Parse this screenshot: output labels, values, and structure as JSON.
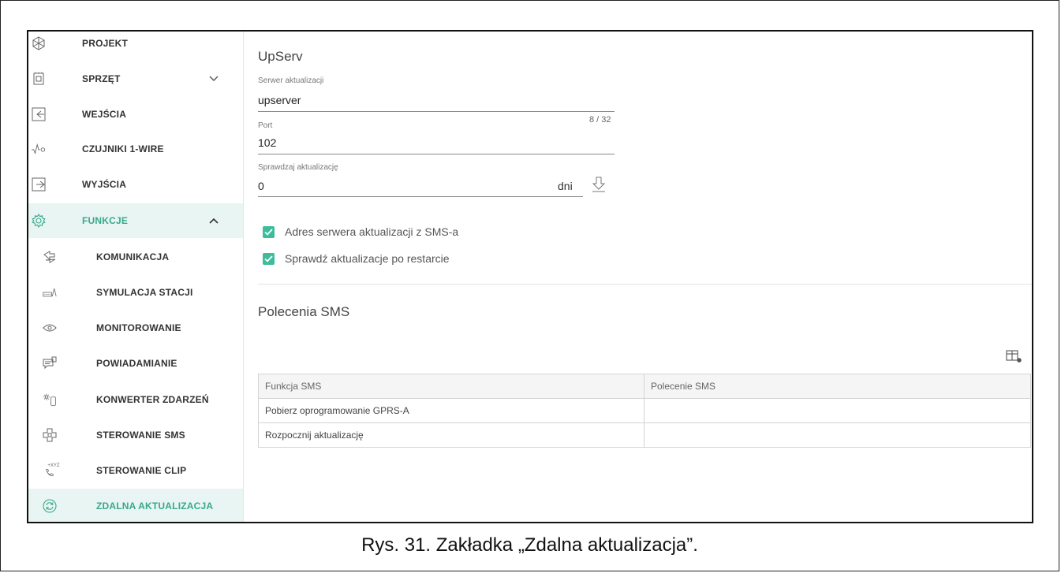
{
  "sidebar": {
    "items": [
      {
        "label": "PROJEKT",
        "icon": "project-icon"
      },
      {
        "label": "SPRZĘT",
        "icon": "hardware-icon",
        "expandable": true,
        "expanded": false
      },
      {
        "label": "WEJŚCIA",
        "icon": "inputs-icon"
      },
      {
        "label": "CZUJNIKI 1-WIRE",
        "icon": "sensor-1wire-icon"
      },
      {
        "label": "WYJŚCIA",
        "icon": "outputs-icon"
      },
      {
        "label": "FUNKCJE",
        "icon": "gear-icon",
        "expandable": true,
        "expanded": true
      },
      {
        "label": "KOMUNIKACJA",
        "icon": "communication-icon"
      },
      {
        "label": "SYMULACJA STACJI",
        "icon": "station-simulation-icon"
      },
      {
        "label": "MONITOROWANIE",
        "icon": "eye-icon"
      },
      {
        "label": "POWIADAMIANIE",
        "icon": "notification-icon"
      },
      {
        "label": "KONWERTER ZDARZEŃ",
        "icon": "event-converter-icon"
      },
      {
        "label": "STEROWANIE SMS",
        "icon": "sms-control-icon"
      },
      {
        "label": "STEROWANIE CLIP",
        "icon": "clip-control-icon",
        "icon_text": "+XYZ"
      },
      {
        "label": "ZDALNA AKTUALIZACJA",
        "icon": "update-icon",
        "active": true
      }
    ]
  },
  "upserv": {
    "title": "UpServ",
    "server": {
      "label": "Serwer aktualizacji",
      "value": "upserver",
      "counter": "8 / 32"
    },
    "port": {
      "label": "Port",
      "value": "102"
    },
    "check": {
      "label": "Sprawdzaj aktualizację",
      "value": "0",
      "unit": "dni",
      "icon": "download-arrow-icon"
    },
    "checkboxes": [
      {
        "label": "Adres serwera aktualizacji z SMS-a",
        "checked": true
      },
      {
        "label": "Sprawdź aktualizacje po restarcie",
        "checked": true
      }
    ]
  },
  "sms": {
    "title": "Polecenia SMS",
    "settings_icon": "table-settings-icon",
    "columns": [
      "Funkcja SMS",
      "Polecenie SMS"
    ],
    "rows": [
      {
        "function": "Pobierz oprogramowanie GPRS-A",
        "command": ""
      },
      {
        "function": "Rozpocznij aktualizację",
        "command": ""
      }
    ]
  },
  "colors": {
    "accent": "#3dbd9b",
    "active_bg": "#e8f5f2",
    "active_text": "#3aa889"
  },
  "caption": "Rys. 31. Zakładka „Zdalna aktualizacja”."
}
